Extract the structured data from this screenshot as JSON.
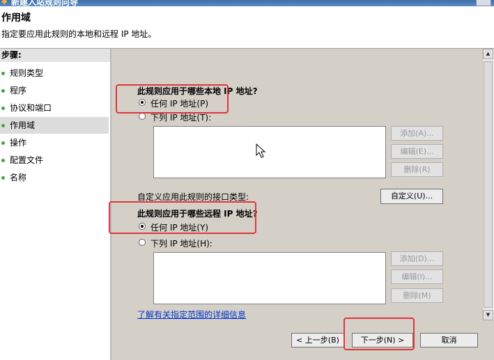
{
  "window": {
    "title": "新建入站规则向导"
  },
  "header": {
    "title": "作用域",
    "subtitle": "指定要应用此规则的本地和远程 IP 地址。"
  },
  "steps": {
    "title": "步骤:",
    "items": [
      {
        "label": "规则类型"
      },
      {
        "label": "程序"
      },
      {
        "label": "协议和端口"
      },
      {
        "label": "作用域"
      },
      {
        "label": "操作"
      },
      {
        "label": "配置文件"
      },
      {
        "label": "名称"
      }
    ],
    "active_index": 3
  },
  "local": {
    "question": "此规则应用于哪些本地 IP 地址?",
    "any_label": "任何 IP 地址(P)",
    "these_label": "下列 IP 地址(T):",
    "selected": "any",
    "add_label": "添加(A)...",
    "edit_label": "编辑(E)...",
    "remove_label": "删除(R)"
  },
  "interface": {
    "label": "自定义应用此规则的接口类型:",
    "button_label": "自定义(U)..."
  },
  "remote": {
    "question": "此规则应用于哪些远程 IP 地址?",
    "any_label": "任何 IP 地址(Y)",
    "these_label": "下列 IP 地址(H):",
    "selected": "any",
    "add_label": "添加(D)...",
    "edit_label": "编辑(I)...",
    "remove_label": "删除(M)"
  },
  "learn_more": "了解有关指定范围的详细信息",
  "footer": {
    "back_label": "< 上一步(B)",
    "next_label": "下一步(N) >",
    "cancel_label": "取消"
  },
  "colors": {
    "highlight": "#e0353c",
    "step_dot": "#46a040",
    "link": "#0033cc"
  }
}
